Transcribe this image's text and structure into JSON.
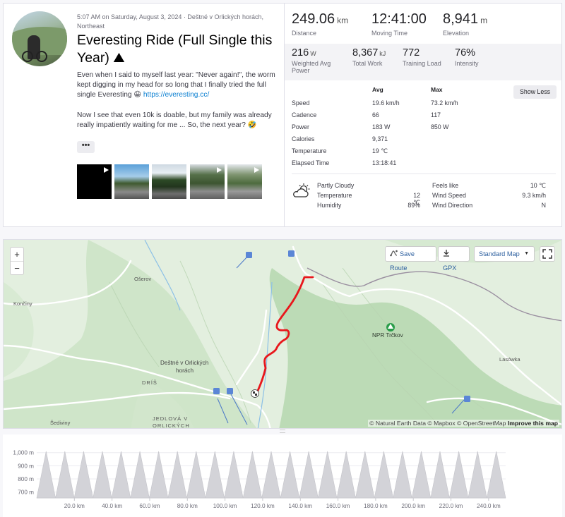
{
  "activity": {
    "meta": "5:07 AM on Saturday, August 3, 2024 · Deštné v Orlických horách, Northeast",
    "title": "Everesting Ride (Full Single this Year) ⛰",
    "desc_p1": "Even when I said to myself last year: \"Never again!\", the worm kept digging in my head for so long that I finally tried the full single Everesting 😀 ",
    "desc_link": "https://everesting.cc/",
    "desc_p2": "Now I see that even 10k is doable, but my family was already really impatiently waiting for me ... So, the next year? 🤣",
    "more_label": "•••"
  },
  "stats": {
    "distance": {
      "value": "249.06",
      "unit": "km",
      "label": "Distance"
    },
    "moving_time": {
      "value": "12:41:00",
      "label": "Moving Time"
    },
    "elevation": {
      "value": "8,941",
      "unit": "m",
      "label": "Elevation"
    },
    "weighted_power": {
      "value": "216",
      "unit": "W",
      "label": "Weighted Avg Power"
    },
    "total_work": {
      "value": "8,367",
      "unit": "kJ",
      "label": "Total Work"
    },
    "training_load": {
      "value": "772",
      "label": "Training Load"
    },
    "intensity": {
      "value": "76%",
      "label": "Intensity"
    }
  },
  "details": {
    "avg_header": "Avg",
    "max_header": "Max",
    "show_less": "Show Less",
    "rows": [
      {
        "label": "Speed",
        "avg": "19.6 km/h",
        "max": "73.2 km/h"
      },
      {
        "label": "Cadence",
        "avg": "66",
        "max": "117"
      },
      {
        "label": "Power",
        "avg": "183 W",
        "max": "850 W"
      },
      {
        "label": "Calories",
        "avg": "9,371",
        "max": ""
      },
      {
        "label": "Temperature",
        "avg": "19 ℃",
        "max": ""
      },
      {
        "label": "Elapsed Time",
        "avg": "13:18:41",
        "max": ""
      }
    ]
  },
  "weather": {
    "condition": "Partly Cloudy",
    "temperature_label": "Temperature",
    "temperature": "12 ℃",
    "humidity_label": "Humidity",
    "humidity": "89%",
    "feels_like_label": "Feels like",
    "feels_like": "10 ℃",
    "wind_speed_label": "Wind Speed",
    "wind_speed": "9.3 km/h",
    "wind_direction_label": "Wind Direction",
    "wind_direction": "N",
    "icon": "partly-cloudy-icon"
  },
  "map": {
    "save_route": "Save Route",
    "gpx": "GPX",
    "map_type": "Standard Map",
    "attribution": "© Natural Earth Data © Mapbox © OpenStreetMap",
    "improve": "Improve this map",
    "places": {
      "oserov": "Ošerov",
      "koncimy": "Končiny",
      "destne": "Deštné v Orlických",
      "horach": "horách",
      "dris": "DRÍŠ",
      "jedlova1": "JEDLOVÁ V",
      "jedlova2": "ORLICKÝCH",
      "sediviny": "Šediviny",
      "trckov": "NPR Trčkov",
      "lasowka": "Lasówka"
    },
    "route_color": "#e8171c"
  },
  "elevation_chart": {
    "y_ticks": [
      "1,000 m",
      "900 m",
      "800 m",
      "700 m"
    ],
    "x_ticks": [
      "20.0 km",
      "40.0 km",
      "60.0 km",
      "80.0 km",
      "100.0 km",
      "120.0 km",
      "140.0 km",
      "160.0 km",
      "180.0 km",
      "200.0 km",
      "220.0 km",
      "240.0 km"
    ],
    "min_elev_m": 655,
    "peak_elev_m": 1010,
    "repeats": 25,
    "total_km": 249.06
  }
}
